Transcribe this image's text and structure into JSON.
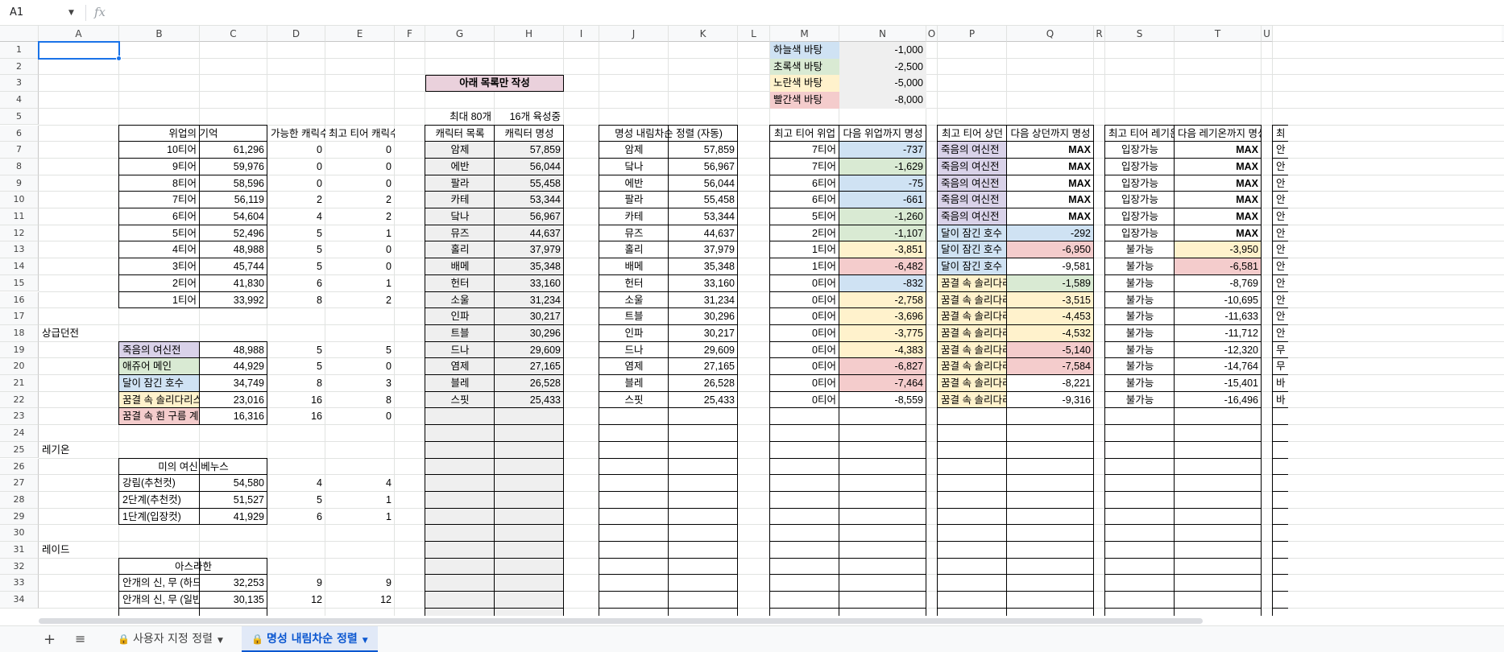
{
  "name_box": {
    "ref": "A1",
    "arrow": "▼",
    "fx": "fx"
  },
  "columns": [
    "A",
    "B",
    "C",
    "D",
    "E",
    "F",
    "G",
    "H",
    "I",
    "J",
    "K",
    "L",
    "M",
    "N",
    "O",
    "P",
    "Q",
    "R",
    "S",
    "T",
    "U"
  ],
  "rows_count": 34,
  "colors": {
    "lilac": "#d9d2e9",
    "mint": "#d9ead3",
    "sky": "#cfe2f3",
    "cream": "#fff2cc",
    "pink": "#f4cccc",
    "grey": "#efefef",
    "titlepink": "#ead1dc",
    "selection": "#1a73e8"
  },
  "legend": [
    {
      "label": "하늘색 바탕",
      "value": "-1,000",
      "color": "sky"
    },
    {
      "label": "초록색 바탕",
      "value": "-2,500",
      "color": "mint"
    },
    {
      "label": "노란색 바탕",
      "value": "-5,000",
      "color": "cream"
    },
    {
      "label": "빨간색 바탕",
      "value": "-8,000",
      "color": "pink"
    }
  ],
  "left": {
    "header": {
      "title": "위업의 기억",
      "possible": "가능한 캐릭수",
      "maxtier": "최고 티어 캐릭수"
    },
    "tiers": [
      {
        "name": "10티어",
        "val": "61,296",
        "d": "0",
        "e": "0"
      },
      {
        "name": "9티어",
        "val": "59,976",
        "d": "0",
        "e": "0"
      },
      {
        "name": "8티어",
        "val": "58,596",
        "d": "0",
        "e": "0"
      },
      {
        "name": "7티어",
        "val": "56,119",
        "d": "2",
        "e": "2"
      },
      {
        "name": "6티어",
        "val": "54,604",
        "d": "4",
        "e": "2"
      },
      {
        "name": "5티어",
        "val": "52,496",
        "d": "5",
        "e": "1"
      },
      {
        "name": "4티어",
        "val": "48,988",
        "d": "5",
        "e": "0"
      },
      {
        "name": "3티어",
        "val": "45,744",
        "d": "5",
        "e": "0"
      },
      {
        "name": "2티어",
        "val": "41,830",
        "d": "6",
        "e": "1"
      },
      {
        "name": "1티어",
        "val": "33,992",
        "d": "8",
        "e": "2"
      }
    ],
    "dungeon_label": "상급던전",
    "dungeons": [
      {
        "name": "죽음의 여신전",
        "val": "48,988",
        "d": "5",
        "e": "5",
        "color": "lilac"
      },
      {
        "name": "애쥬어 메인",
        "val": "44,929",
        "d": "5",
        "e": "0",
        "color": "mint"
      },
      {
        "name": "달이 잠긴 호수",
        "val": "34,749",
        "d": "8",
        "e": "3",
        "color": "sky"
      },
      {
        "name": "꿈결 속 솔리다리스",
        "val": "23,016",
        "d": "16",
        "e": "8",
        "color": "cream"
      },
      {
        "name": "꿈결 속 흰 구름 계곡",
        "val": "16,316",
        "d": "16",
        "e": "0",
        "color": "pink"
      }
    ],
    "legion_label": "레기온",
    "legion_title": "미의 여신 베누스",
    "legion": [
      {
        "name": "강림(추천컷)",
        "val": "54,580",
        "d": "4",
        "e": "4"
      },
      {
        "name": "2단계(추천컷)",
        "val": "51,527",
        "d": "5",
        "e": "1"
      },
      {
        "name": "1단계(입장컷)",
        "val": "41,929",
        "d": "6",
        "e": "1"
      }
    ],
    "raid_label": "레이드",
    "raid_title": "아스라한",
    "raid": [
      {
        "name": "안개의 신, 무 (하드)",
        "val": "32,253",
        "d": "9",
        "e": "9"
      },
      {
        "name": "안개의 신, 무 (일반)",
        "val": "30,135",
        "d": "12",
        "e": "12"
      }
    ]
  },
  "char_input": {
    "note": "아래 목록만 작성",
    "max_label": "최대 80개",
    "count_label": "16개 육성중",
    "col_name": "캐릭터 목록",
    "col_fame": "캐릭터 명성",
    "rows": [
      [
        "암제",
        "57,859"
      ],
      [
        "에반",
        "56,044"
      ],
      [
        "팔라",
        "55,458"
      ],
      [
        "카테",
        "53,344"
      ],
      [
        "닼나",
        "56,967"
      ],
      [
        "뮤즈",
        "44,637"
      ],
      [
        "홀리",
        "37,979"
      ],
      [
        "배메",
        "35,348"
      ],
      [
        "헌터",
        "33,160"
      ],
      [
        "소울",
        "31,234"
      ],
      [
        "인파",
        "30,217"
      ],
      [
        "트블",
        "30,296"
      ],
      [
        "드나",
        "29,609"
      ],
      [
        "염제",
        "27,165"
      ],
      [
        "블레",
        "26,528"
      ],
      [
        "스핏",
        "25,433"
      ]
    ]
  },
  "sorted": {
    "title": "명성 내림차순 정렬 (자동)",
    "rows": [
      [
        "암제",
        "57,859"
      ],
      [
        "닼나",
        "56,967"
      ],
      [
        "에반",
        "56,044"
      ],
      [
        "팔라",
        "55,458"
      ],
      [
        "카테",
        "53,344"
      ],
      [
        "뮤즈",
        "44,637"
      ],
      [
        "홀리",
        "37,979"
      ],
      [
        "배메",
        "35,348"
      ],
      [
        "헌터",
        "33,160"
      ],
      [
        "소울",
        "31,234"
      ],
      [
        "트블",
        "30,296"
      ],
      [
        "인파",
        "30,217"
      ],
      [
        "드나",
        "29,609"
      ],
      [
        "염제",
        "27,165"
      ],
      [
        "블레",
        "26,528"
      ],
      [
        "스핏",
        "25,433"
      ]
    ]
  },
  "tier": {
    "col1": "최고 티어 위업",
    "col2": "다음 위업까지 명성",
    "rows": [
      [
        "7티어",
        "-737",
        "sky"
      ],
      [
        "7티어",
        "-1,629",
        "mint"
      ],
      [
        "6티어",
        "-75",
        "sky"
      ],
      [
        "6티어",
        "-661",
        "sky"
      ],
      [
        "5티어",
        "-1,260",
        "mint"
      ],
      [
        "2티어",
        "-1,107",
        "mint"
      ],
      [
        "1티어",
        "-3,851",
        "cream"
      ],
      [
        "1티어",
        "-6,482",
        "pink"
      ],
      [
        "0티어",
        "-832",
        "sky"
      ],
      [
        "0티어",
        "-2,758",
        "cream"
      ],
      [
        "0티어",
        "-3,696",
        "cream"
      ],
      [
        "0티어",
        "-3,775",
        "cream"
      ],
      [
        "0티어",
        "-4,383",
        "cream"
      ],
      [
        "0티어",
        "-6,827",
        "pink"
      ],
      [
        "0티어",
        "-7,464",
        "pink"
      ],
      [
        "0티어",
        "-8,559",
        ""
      ]
    ]
  },
  "dungeon": {
    "col1": "최고 티어 상던",
    "col2": "다음 상던까지 명성",
    "rows": [
      [
        "죽음의 여신전",
        "lilac",
        "MAX",
        ""
      ],
      [
        "죽음의 여신전",
        "lilac",
        "MAX",
        ""
      ],
      [
        "죽음의 여신전",
        "lilac",
        "MAX",
        ""
      ],
      [
        "죽음의 여신전",
        "lilac",
        "MAX",
        ""
      ],
      [
        "죽음의 여신전",
        "lilac",
        "MAX",
        ""
      ],
      [
        "달이 잠긴 호수",
        "sky",
        "-292",
        "sky"
      ],
      [
        "달이 잠긴 호수",
        "sky",
        "-6,950",
        "pink"
      ],
      [
        "달이 잠긴 호수",
        "sky",
        "-9,581",
        ""
      ],
      [
        "꿈결 속 솔리다리스",
        "cream",
        "-1,589",
        "mint"
      ],
      [
        "꿈결 속 솔리다리스",
        "cream",
        "-3,515",
        "cream"
      ],
      [
        "꿈결 속 솔리다리스",
        "cream",
        "-4,453",
        "cream"
      ],
      [
        "꿈결 속 솔리다리스",
        "cream",
        "-4,532",
        "cream"
      ],
      [
        "꿈결 속 솔리다리스",
        "cream",
        "-5,140",
        "pink"
      ],
      [
        "꿈결 속 솔리다리스",
        "cream",
        "-7,584",
        "pink"
      ],
      [
        "꿈결 속 솔리다리스",
        "cream",
        "-8,221",
        ""
      ],
      [
        "꿈결 속 솔리다리스",
        "cream",
        "-9,316",
        ""
      ]
    ]
  },
  "legion_status": {
    "col1": "최고 티어 레기온",
    "col2": "다음 레기온까지 명성",
    "rows": [
      [
        "입장가능",
        "MAX",
        ""
      ],
      [
        "입장가능",
        "MAX",
        ""
      ],
      [
        "입장가능",
        "MAX",
        ""
      ],
      [
        "입장가능",
        "MAX",
        ""
      ],
      [
        "입장가능",
        "MAX",
        ""
      ],
      [
        "입장가능",
        "MAX",
        ""
      ],
      [
        "불가능",
        "-3,950",
        "cream"
      ],
      [
        "불가능",
        "-6,581",
        "pink"
      ],
      [
        "불가능",
        "-8,769",
        ""
      ],
      [
        "불가능",
        "-10,695",
        ""
      ],
      [
        "불가능",
        "-11,633",
        ""
      ],
      [
        "불가능",
        "-11,712",
        ""
      ],
      [
        "불가능",
        "-12,320",
        ""
      ],
      [
        "불가능",
        "-14,764",
        ""
      ],
      [
        "불가능",
        "-15,401",
        ""
      ],
      [
        "불가능",
        "-16,496",
        ""
      ]
    ]
  },
  "u_col": {
    "header": "최",
    "rows": [
      "안",
      "안",
      "안",
      "안",
      "안",
      "안",
      "안",
      "안",
      "안",
      "안",
      "안",
      "안",
      "무",
      "무",
      "바",
      "바"
    ]
  },
  "sheet_tabs": {
    "add": "+",
    "all": "≡",
    "tab1": "사용자 지정 정렬",
    "tab2": "명성 내림차순 정렬",
    "lock": "🔒",
    "arrow": "▼"
  }
}
